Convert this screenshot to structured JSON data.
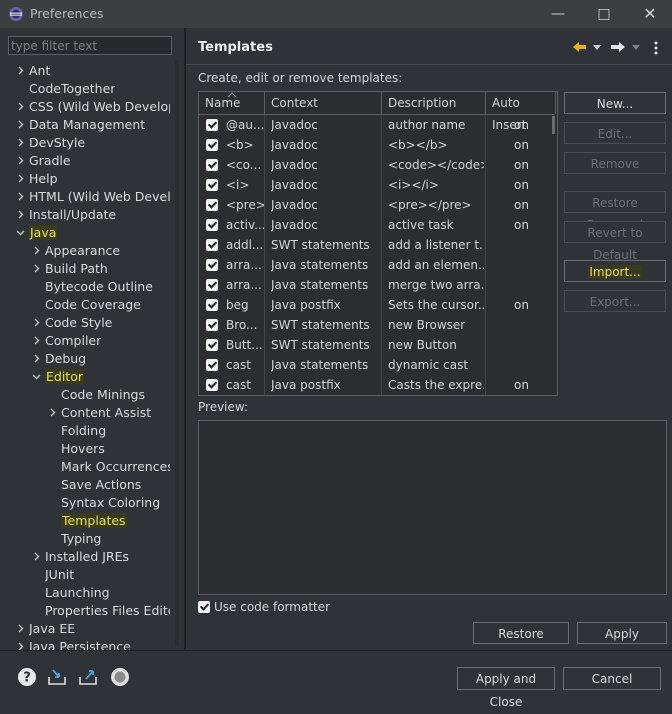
{
  "window": {
    "title": "Preferences"
  },
  "filter": {
    "placeholder": "type filter text"
  },
  "tree": [
    {
      "label": "Ant",
      "depth": 0,
      "exp": ">"
    },
    {
      "label": "CodeTogether",
      "depth": 0,
      "exp": ""
    },
    {
      "label": "CSS (Wild Web Developer",
      "depth": 0,
      "exp": ">"
    },
    {
      "label": "Data Management",
      "depth": 0,
      "exp": ">"
    },
    {
      "label": "DevStyle",
      "depth": 0,
      "exp": ">"
    },
    {
      "label": "Gradle",
      "depth": 0,
      "exp": ">"
    },
    {
      "label": "Help",
      "depth": 0,
      "exp": ">"
    },
    {
      "label": "HTML (Wild Web Develop",
      "depth": 0,
      "exp": ">"
    },
    {
      "label": "Install/Update",
      "depth": 0,
      "exp": ">"
    },
    {
      "label": "Java",
      "depth": 0,
      "exp": "v",
      "hl": true
    },
    {
      "label": "Appearance",
      "depth": 1,
      "exp": ">"
    },
    {
      "label": "Build Path",
      "depth": 1,
      "exp": ">"
    },
    {
      "label": "Bytecode Outline",
      "depth": 1,
      "exp": ""
    },
    {
      "label": "Code Coverage",
      "depth": 1,
      "exp": ""
    },
    {
      "label": "Code Style",
      "depth": 1,
      "exp": ">"
    },
    {
      "label": "Compiler",
      "depth": 1,
      "exp": ">"
    },
    {
      "label": "Debug",
      "depth": 1,
      "exp": ">"
    },
    {
      "label": "Editor",
      "depth": 1,
      "exp": "v",
      "hl": true
    },
    {
      "label": "Code Minings",
      "depth": 2,
      "exp": ""
    },
    {
      "label": "Content Assist",
      "depth": 2,
      "exp": ">"
    },
    {
      "label": "Folding",
      "depth": 2,
      "exp": ""
    },
    {
      "label": "Hovers",
      "depth": 2,
      "exp": ""
    },
    {
      "label": "Mark Occurrences",
      "depth": 2,
      "exp": ""
    },
    {
      "label": "Save Actions",
      "depth": 2,
      "exp": ""
    },
    {
      "label": "Syntax Coloring",
      "depth": 2,
      "exp": ""
    },
    {
      "label": "Templates",
      "depth": 2,
      "exp": "",
      "hl": true
    },
    {
      "label": "Typing",
      "depth": 2,
      "exp": ""
    },
    {
      "label": "Installed JREs",
      "depth": 1,
      "exp": ">"
    },
    {
      "label": "JUnit",
      "depth": 1,
      "exp": ""
    },
    {
      "label": "Launching",
      "depth": 1,
      "exp": ""
    },
    {
      "label": "Properties Files Editor",
      "depth": 1,
      "exp": ""
    },
    {
      "label": "Java EE",
      "depth": 0,
      "exp": ">"
    },
    {
      "label": "Java Persistence",
      "depth": 0,
      "exp": ">"
    }
  ],
  "page": {
    "title": "Templates",
    "description": "Create, edit or remove templates:",
    "preview_label": "Preview:",
    "use_formatter_label": "Use code formatter"
  },
  "table": {
    "columns": [
      "Name",
      "Context",
      "Description",
      "Auto Insert"
    ],
    "rows": [
      {
        "name": "@au...",
        "context": "Javadoc",
        "description": "author name",
        "auto": "on"
      },
      {
        "name": "<b>",
        "context": "Javadoc",
        "description": "<b></b>",
        "auto": "on"
      },
      {
        "name": "<co...",
        "context": "Javadoc",
        "description": "<code></code>",
        "auto": "on"
      },
      {
        "name": "<i>",
        "context": "Javadoc",
        "description": "<i></i>",
        "auto": "on"
      },
      {
        "name": "<pre>",
        "context": "Javadoc",
        "description": "<pre></pre>",
        "auto": "on"
      },
      {
        "name": "activ...",
        "context": "Javadoc",
        "description": "active task",
        "auto": "on"
      },
      {
        "name": "addl...",
        "context": "SWT statements",
        "description": "add a listener t...",
        "auto": ""
      },
      {
        "name": "arra...",
        "context": "Java statements",
        "description": "add an elemen...",
        "auto": ""
      },
      {
        "name": "arra...",
        "context": "Java statements",
        "description": "merge two arra...",
        "auto": ""
      },
      {
        "name": "beg",
        "context": "Java postfix",
        "description": "Sets the cursor...",
        "auto": "on"
      },
      {
        "name": "Bro...",
        "context": "SWT statements",
        "description": "new Browser",
        "auto": ""
      },
      {
        "name": "Butt...",
        "context": "SWT statements",
        "description": "new Button",
        "auto": ""
      },
      {
        "name": "cast",
        "context": "Java statements",
        "description": "dynamic cast",
        "auto": ""
      },
      {
        "name": "cast",
        "context": "Java postfix",
        "description": "Casts the expre...",
        "auto": "on"
      }
    ]
  },
  "buttons": {
    "new": "New...",
    "edit": "Edit...",
    "remove": "Remove",
    "restore_removed": "Restore Removed",
    "revert_default": "Revert to Default",
    "import": "Import...",
    "export": "Export...",
    "restore_defaults": "Restore Defaults",
    "apply": "Apply",
    "apply_close": "Apply and Close",
    "cancel": "Cancel"
  }
}
